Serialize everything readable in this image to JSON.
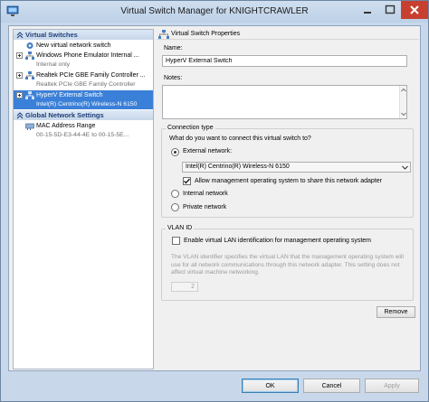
{
  "window": {
    "title": "Virtual Switch Manager for KNIGHTCRAWLER",
    "icon": "hyperv-manager-icon"
  },
  "tree": {
    "virtual_switches_header": "Virtual Switches",
    "items": [
      {
        "label": "New virtual network switch",
        "sub": "",
        "icon": "new-switch-icon",
        "expandable": false
      },
      {
        "label": "Windows Phone Emulator Internal ...",
        "sub": "Internal only",
        "icon": "network-switch-icon",
        "expandable": true
      },
      {
        "label": "Realtek PCIe GBE Family Controller ...",
        "sub": "Realtek PCIe GBE Family Controller",
        "icon": "network-switch-icon",
        "expandable": true
      },
      {
        "label": "HyperV External Switch",
        "sub": "Intel(R) Centrino(R) Wireless-N 6150",
        "icon": "network-switch-icon",
        "expandable": true,
        "selected": true
      }
    ],
    "global_header": "Global Network Settings",
    "global_items": [
      {
        "label": "MAC Address Range",
        "sub": "00-15-5D-E3-44-4E to 00-15-5E..."
      }
    ]
  },
  "properties": {
    "header": "Virtual Switch Properties",
    "name_label": "Name:",
    "name_value": "HyperV External Switch",
    "notes_label": "Notes:",
    "notes_value": "",
    "connection_type": {
      "title": "Connection type",
      "question": "What do you want to connect this virtual switch to?",
      "external_label": "External network:",
      "adapter_selected": "Intel(R) Centrino(R) Wireless-N 6150",
      "allow_mgmt_label": "Allow management operating system to share this network adapter",
      "allow_mgmt_checked": true,
      "internal_label": "Internal network",
      "private_label": "Private network",
      "selected": "external"
    },
    "vlan": {
      "title": "VLAN ID",
      "enable_label": "Enable virtual LAN identification for management operating system",
      "enable_checked": false,
      "help": "The VLAN identifier specifies the virtual LAN that the management operating system will use for all network communications through this network adapter. This setting does not affect virtual machine networking.",
      "vlan_value": "2"
    },
    "remove_label": "Remove"
  },
  "footer": {
    "ok_label": "OK",
    "cancel_label": "Cancel",
    "apply_label": "Apply"
  }
}
